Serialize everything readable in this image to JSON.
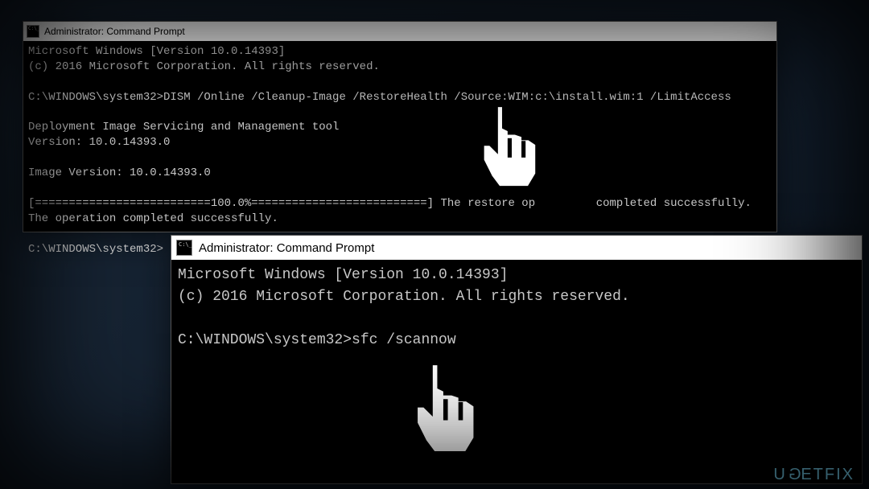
{
  "window1": {
    "title": "Administrator: Command Prompt",
    "lines": {
      "l0": "Microsoft Windows [Version 10.0.14393]",
      "l1": "(c) 2016 Microsoft Corporation. All rights reserved.",
      "l2": "",
      "l3": "C:\\WINDOWS\\system32>DISM /Online /Cleanup-Image /RestoreHealth /Source:WIM:c:\\install.wim:1 /LimitAccess",
      "l4": "",
      "l5": "Deployment Image Servicing and Management tool",
      "l6": "Version: 10.0.14393.0",
      "l7": "",
      "l8": "Image Version: 10.0.14393.0",
      "l9": "",
      "l10": "[==========================100.0%==========================] The restore op         completed successfully.",
      "l11": "The operation completed successfully.",
      "l12": "",
      "l13": "C:\\WINDOWS\\system32>"
    }
  },
  "window2": {
    "title": "Administrator: Command Prompt",
    "lines": {
      "l0": "Microsoft Windows [Version 10.0.14393]",
      "l1": "(c) 2016 Microsoft Corporation. All rights reserved.",
      "l2": "",
      "l3": "C:\\WINDOWS\\system32>sfc /scannow"
    }
  },
  "watermark": "UGETFIX"
}
